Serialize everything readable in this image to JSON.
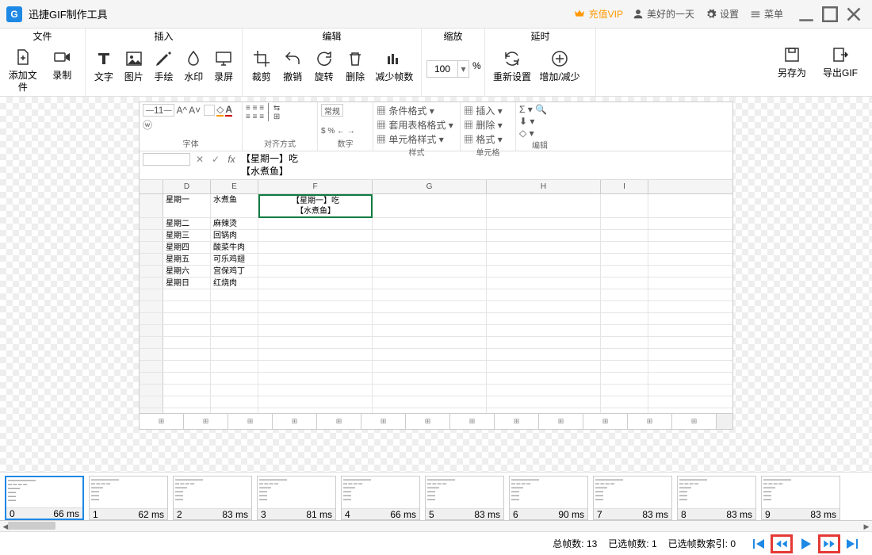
{
  "title": "迅捷GIF制作工具",
  "header": {
    "vip": "充值VIP",
    "user": "美好的一天",
    "settings": "设置",
    "menu": "菜单"
  },
  "ribbon": {
    "groups": {
      "file": {
        "label": "文件",
        "items": {
          "addfile": "添加文件",
          "record": "录制"
        }
      },
      "insert": {
        "label": "插入",
        "items": {
          "text": "文字",
          "image": "图片",
          "draw": "手绘",
          "watermark": "水印",
          "screen": "录屏"
        }
      },
      "edit": {
        "label": "编辑",
        "items": {
          "crop": "裁剪",
          "undo": "撤销",
          "rotate": "旋转",
          "delete": "删除",
          "reduceframes": "减少帧数"
        }
      },
      "zoom": {
        "label": "缩放",
        "value": "100",
        "pct": "%"
      },
      "delay": {
        "label": "延时",
        "items": {
          "reset": "重新设置",
          "addsub": "增加/减少"
        }
      }
    },
    "right": {
      "saveas": "另存为",
      "export": "导出GIF"
    }
  },
  "excel": {
    "ribbon": {
      "general": "常规",
      "condformat": "条件格式",
      "tableformat": "套用表格格式",
      "cellstyle": "单元格样式",
      "insert": "插入",
      "delete": "删除",
      "format": "格式",
      "grp_font": "字体",
      "grp_align": "对齐方式",
      "grp_num": "数字",
      "grp_style": "样式",
      "grp_cell": "单元格",
      "grp_edit": "编辑",
      "fontsize": "11"
    },
    "formula": {
      "line1": "【星期一】吃",
      "line2": "【水煮鱼】"
    },
    "cols": [
      "D",
      "E",
      "F",
      "G",
      "H",
      "I"
    ],
    "selected_cell": "【星期一】吃\n【水煮鱼】",
    "rows": [
      {
        "d": "星期一",
        "e": "水煮鱼"
      },
      {
        "d": "星期二",
        "e": "麻辣烫"
      },
      {
        "d": "星期三",
        "e": "回锅肉"
      },
      {
        "d": "星期四",
        "e": "酸菜牛肉"
      },
      {
        "d": "星期五",
        "e": "可乐鸡翅"
      },
      {
        "d": "星期六",
        "e": "宫保鸡丁"
      },
      {
        "d": "星期日",
        "e": "红烧肉"
      }
    ]
  },
  "frames": [
    {
      "idx": "0",
      "dur": "66 ms",
      "sel": true
    },
    {
      "idx": "1",
      "dur": "62 ms"
    },
    {
      "idx": "2",
      "dur": "83 ms"
    },
    {
      "idx": "3",
      "dur": "81 ms"
    },
    {
      "idx": "4",
      "dur": "66 ms"
    },
    {
      "idx": "5",
      "dur": "83 ms"
    },
    {
      "idx": "6",
      "dur": "90 ms"
    },
    {
      "idx": "7",
      "dur": "83 ms"
    },
    {
      "idx": "8",
      "dur": "83 ms"
    },
    {
      "idx": "9",
      "dur": "83 ms"
    }
  ],
  "status": {
    "total_label": "总帧数:",
    "total": "13",
    "sel_label": "已选帧数:",
    "sel": "1",
    "idx_label": "已选帧数索引:",
    "idx": "0"
  }
}
